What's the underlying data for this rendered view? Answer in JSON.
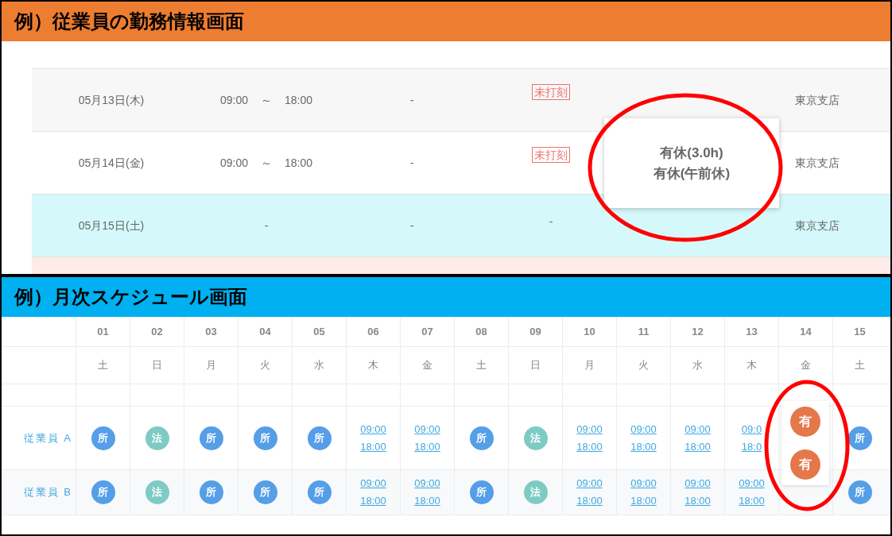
{
  "attendance_panel": {
    "title": "例）従業員の勤務情報画面",
    "rows": [
      {
        "kind": "weekday",
        "date": "05月13日(木)",
        "start": "09:00",
        "tilde": "～",
        "end": "18:00",
        "column_3": "-",
        "column_4": {
          "kind": "alert",
          "text": "未打刻"
        },
        "location": "東京支店"
      },
      {
        "kind": "weekday",
        "date": "05月14日(金)",
        "start": "09:00",
        "tilde": "～",
        "end": "18:00",
        "column_3": "-",
        "column_4": {
          "kind": "alert",
          "text": "未打刻"
        },
        "location": "東京支店"
      },
      {
        "kind": "saturday",
        "date": "05月15日(土)",
        "time": "-",
        "column_3": "-",
        "column_4": {
          "kind": "text",
          "text": "-"
        },
        "location": "東京支店"
      },
      {
        "kind": "sunday"
      }
    ],
    "popup": {
      "lines": [
        "有休(3.0h)",
        "有休(午前休)"
      ]
    }
  },
  "schedule_panel": {
    "title": "例）月次スケジュール画面",
    "days": [
      {
        "day": "01",
        "weekday": "土"
      },
      {
        "day": "02",
        "weekday": "日"
      },
      {
        "day": "03",
        "weekday": "月"
      },
      {
        "day": "04",
        "weekday": "火"
      },
      {
        "day": "05",
        "weekday": "水"
      },
      {
        "day": "06",
        "weekday": "木"
      },
      {
        "day": "07",
        "weekday": "金"
      },
      {
        "day": "08",
        "weekday": "土"
      },
      {
        "day": "09",
        "weekday": "日"
      },
      {
        "day": "10",
        "weekday": "月"
      },
      {
        "day": "11",
        "weekday": "火"
      },
      {
        "day": "12",
        "weekday": "水"
      },
      {
        "day": "13",
        "weekday": "木"
      },
      {
        "day": "14",
        "weekday": "金"
      },
      {
        "day": "15",
        "weekday": "土"
      }
    ],
    "employees": [
      {
        "name": "従業員 A",
        "cells": [
          {
            "kind": "badge",
            "label": "所",
            "color": "#559ee8"
          },
          {
            "kind": "badge",
            "label": "法",
            "color": "#7ecbc4"
          },
          {
            "kind": "badge",
            "label": "所",
            "color": "#559ee8"
          },
          {
            "kind": "badge",
            "label": "所",
            "color": "#559ee8"
          },
          {
            "kind": "badge",
            "label": "所",
            "color": "#559ee8"
          },
          {
            "kind": "time",
            "start": "09:00",
            "end": "18:00"
          },
          {
            "kind": "time",
            "start": "09:00",
            "end": "18:00"
          },
          {
            "kind": "badge",
            "label": "所",
            "color": "#559ee8"
          },
          {
            "kind": "badge",
            "label": "法",
            "color": "#7ecbc4"
          },
          {
            "kind": "time",
            "start": "09:00",
            "end": "18:00"
          },
          {
            "kind": "time",
            "start": "09:00",
            "end": "18:00"
          },
          {
            "kind": "time",
            "start": "09:00",
            "end": "18:00"
          },
          {
            "kind": "time",
            "start": "09:0",
            "end": "18:0"
          },
          {
            "kind": "empty"
          },
          {
            "kind": "badge",
            "label": "所",
            "color": "#559ee8"
          }
        ]
      },
      {
        "name": "従業員 B",
        "cells": [
          {
            "kind": "badge",
            "label": "所",
            "color": "#559ee8"
          },
          {
            "kind": "badge",
            "label": "法",
            "color": "#7ecbc4"
          },
          {
            "kind": "badge",
            "label": "所",
            "color": "#559ee8"
          },
          {
            "kind": "badge",
            "label": "所",
            "color": "#559ee8"
          },
          {
            "kind": "badge",
            "label": "所",
            "color": "#559ee8"
          },
          {
            "kind": "time",
            "start": "09:00",
            "end": "18:00"
          },
          {
            "kind": "time",
            "start": "09:00",
            "end": "18:00"
          },
          {
            "kind": "badge",
            "label": "所",
            "color": "#559ee8"
          },
          {
            "kind": "badge",
            "label": "法",
            "color": "#7ecbc4"
          },
          {
            "kind": "time",
            "start": "09:00",
            "end": "18:00"
          },
          {
            "kind": "time",
            "start": "09:00",
            "end": "18:00"
          },
          {
            "kind": "time",
            "start": "09:00",
            "end": "18:00"
          },
          {
            "kind": "time",
            "start": "09:00",
            "end": "18:00"
          },
          {
            "kind": "empty"
          },
          {
            "kind": "badge",
            "label": "所",
            "color": "#559ee8"
          }
        ]
      }
    ],
    "popup": {
      "badges": [
        {
          "label": "有",
          "color": "#e4784b"
        },
        {
          "label": "有",
          "color": "#e4784b"
        }
      ]
    }
  }
}
